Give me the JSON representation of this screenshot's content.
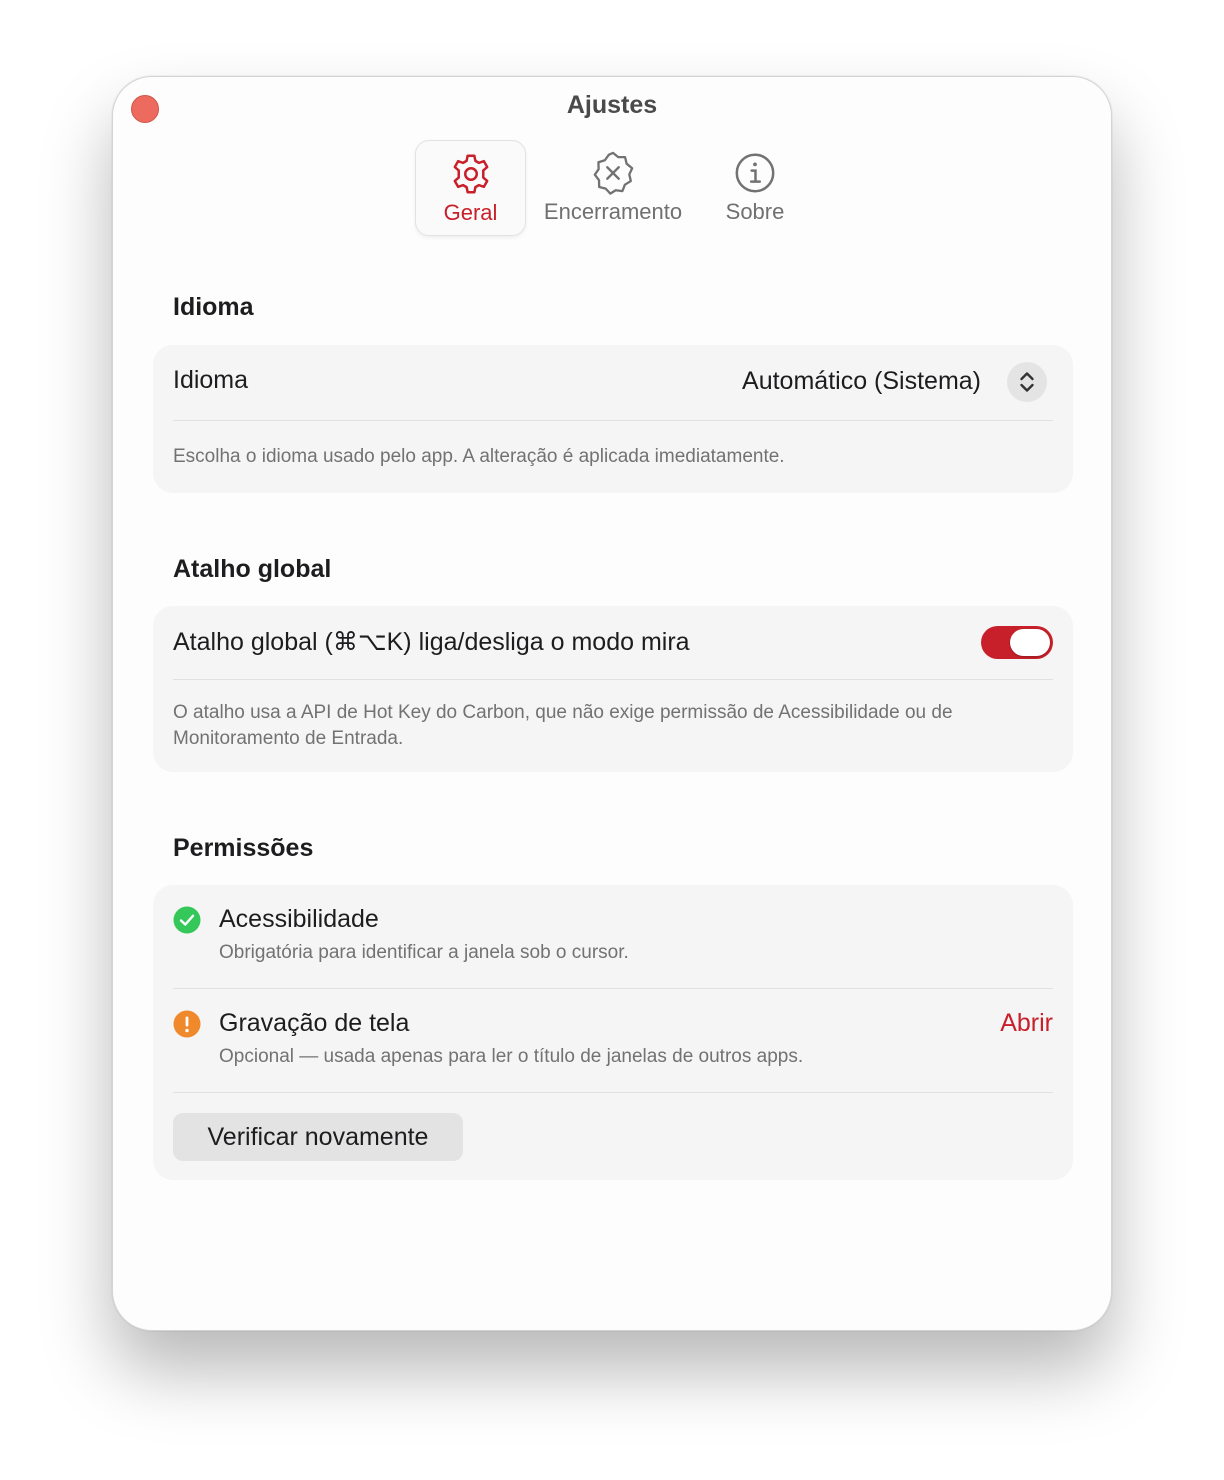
{
  "window": {
    "title": "Ajustes"
  },
  "tabs": [
    {
      "label": "Geral",
      "icon": "gear-icon",
      "active": true
    },
    {
      "label": "Encerramento",
      "icon": "xmark-seal-icon",
      "active": false
    },
    {
      "label": "Sobre",
      "icon": "info-circle-icon",
      "active": false
    }
  ],
  "language": {
    "section_title": "Idioma",
    "row_label": "Idioma",
    "selected_value": "Automático (Sistema)",
    "footnote": "Escolha o idioma usado pelo app. A alteração é aplicada imediatamente."
  },
  "shortcut": {
    "section_title": "Atalho global",
    "row_label": "Atalho global (⌘⌥K) liga/desliga o modo mira",
    "toggle_on": true,
    "footnote": "O atalho usa a API de Hot Key do Carbon, que não exige permissão de Acessibilidade ou de Monitoramento de Entrada."
  },
  "permissions": {
    "section_title": "Permissões",
    "items": [
      {
        "title": "Acessibilidade",
        "description": "Obrigatória para identificar a janela sob o cursor.",
        "status": "granted",
        "status_color": "#34c759",
        "icon": "checkmark-circle-icon"
      },
      {
        "title": "Gravação de tela",
        "description": "Opcional — usada apenas para ler o título de janelas de outros apps.",
        "status": "warning",
        "status_color": "#f0882c",
        "icon": "exclamation-circle-icon",
        "action_label": "Abrir"
      }
    ],
    "recheck_label": "Verificar novamente"
  },
  "colors": {
    "accent": "#c8202a",
    "close_button": "#ec6a5e"
  }
}
